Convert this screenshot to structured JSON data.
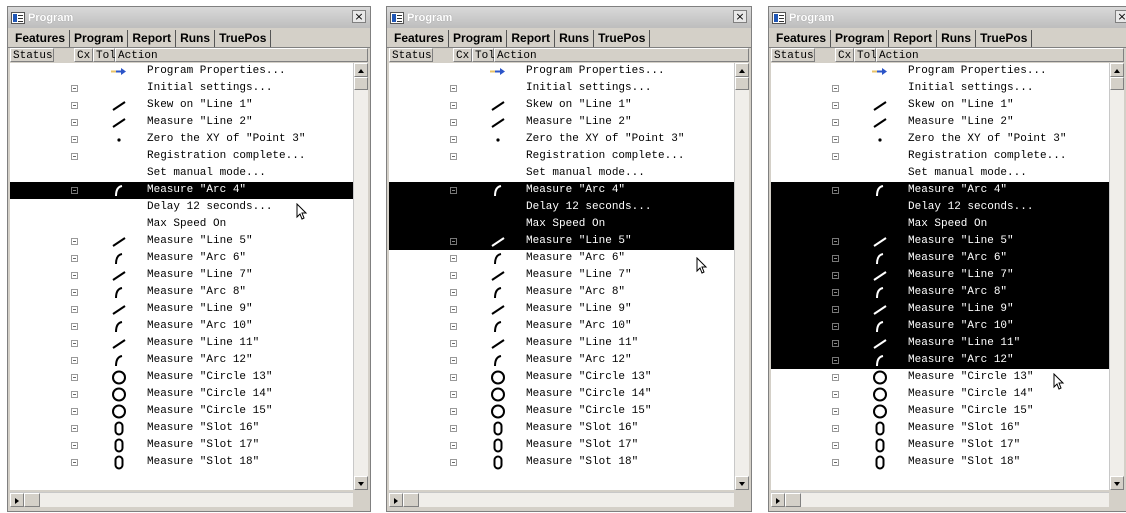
{
  "windows": [
    {
      "title": "Program",
      "close": "×",
      "tabs": [
        "Features",
        "Program",
        "Report",
        "Runs",
        "TruePos"
      ],
      "columns": {
        "status": "Status",
        "cx": "Cx",
        "tol": "Tol",
        "action": "Action"
      },
      "rows": [
        {
          "icon": "arrow",
          "text": "Program Properties...",
          "expander": false,
          "selected": false
        },
        {
          "icon": "none",
          "text": "Initial settings...",
          "expander": true,
          "selected": false
        },
        {
          "icon": "line",
          "text": "Skew on \"Line 1\"",
          "expander": true,
          "selected": false
        },
        {
          "icon": "line",
          "text": "Measure \"Line 2\"",
          "expander": true,
          "selected": false
        },
        {
          "icon": "point",
          "text": "Zero the XY of \"Point 3\"",
          "expander": true,
          "selected": false
        },
        {
          "icon": "none",
          "text": "Registration complete...",
          "expander": true,
          "selected": false
        },
        {
          "icon": "none",
          "text": "Set manual mode...",
          "expander": false,
          "selected": false
        },
        {
          "icon": "arc",
          "text": "Measure \"Arc 4\"",
          "expander": true,
          "selected": true
        },
        {
          "icon": "none",
          "text": "Delay 12 seconds...",
          "expander": false,
          "selected": false
        },
        {
          "icon": "none",
          "text": "Max Speed On",
          "expander": false,
          "selected": false
        },
        {
          "icon": "line",
          "text": "Measure \"Line 5\"",
          "expander": true,
          "selected": false
        },
        {
          "icon": "arc",
          "text": "Measure \"Arc 6\"",
          "expander": true,
          "selected": false
        },
        {
          "icon": "line",
          "text": "Measure \"Line 7\"",
          "expander": true,
          "selected": false
        },
        {
          "icon": "arc",
          "text": "Measure \"Arc 8\"",
          "expander": true,
          "selected": false
        },
        {
          "icon": "line",
          "text": "Measure \"Line 9\"",
          "expander": true,
          "selected": false
        },
        {
          "icon": "arc",
          "text": "Measure \"Arc 10\"",
          "expander": true,
          "selected": false
        },
        {
          "icon": "line",
          "text": "Measure \"Line 11\"",
          "expander": true,
          "selected": false
        },
        {
          "icon": "arc",
          "text": "Measure \"Arc 12\"",
          "expander": true,
          "selected": false
        },
        {
          "icon": "circle",
          "text": "Measure \"Circle 13\"",
          "expander": true,
          "selected": false
        },
        {
          "icon": "circle",
          "text": "Measure \"Circle 14\"",
          "expander": true,
          "selected": false
        },
        {
          "icon": "circle",
          "text": "Measure \"Circle 15\"",
          "expander": true,
          "selected": false
        },
        {
          "icon": "slot",
          "text": "Measure \"Slot 16\"",
          "expander": true,
          "selected": false
        },
        {
          "icon": "slot",
          "text": "Measure \"Slot 17\"",
          "expander": true,
          "selected": false
        },
        {
          "icon": "slot",
          "text": "Measure \"Slot 18\"",
          "expander": true,
          "selected": false
        }
      ]
    },
    {
      "title": "Program",
      "close": "×",
      "tabs": [
        "Features",
        "Program",
        "Report",
        "Runs",
        "TruePos"
      ],
      "columns": {
        "status": "Status",
        "cx": "Cx",
        "tol": "Tol",
        "action": "Action"
      },
      "rows": [
        {
          "icon": "arrow",
          "text": "Program Properties...",
          "expander": false,
          "selected": false
        },
        {
          "icon": "none",
          "text": "Initial settings...",
          "expander": true,
          "selected": false
        },
        {
          "icon": "line",
          "text": "Skew on \"Line 1\"",
          "expander": true,
          "selected": false
        },
        {
          "icon": "line",
          "text": "Measure \"Line 2\"",
          "expander": true,
          "selected": false
        },
        {
          "icon": "point",
          "text": "Zero the XY of \"Point 3\"",
          "expander": true,
          "selected": false
        },
        {
          "icon": "none",
          "text": "Registration complete...",
          "expander": true,
          "selected": false
        },
        {
          "icon": "none",
          "text": "Set manual mode...",
          "expander": false,
          "selected": false
        },
        {
          "icon": "arc",
          "text": "Measure \"Arc 4\"",
          "expander": true,
          "selected": true
        },
        {
          "icon": "none",
          "text": "Delay 12 seconds...",
          "expander": false,
          "selected": true
        },
        {
          "icon": "none",
          "text": "Max Speed On",
          "expander": false,
          "selected": true
        },
        {
          "icon": "line",
          "text": "Measure \"Line 5\"",
          "expander": true,
          "selected": true
        },
        {
          "icon": "arc",
          "text": "Measure \"Arc 6\"",
          "expander": true,
          "selected": false
        },
        {
          "icon": "line",
          "text": "Measure \"Line 7\"",
          "expander": true,
          "selected": false
        },
        {
          "icon": "arc",
          "text": "Measure \"Arc 8\"",
          "expander": true,
          "selected": false
        },
        {
          "icon": "line",
          "text": "Measure \"Line 9\"",
          "expander": true,
          "selected": false
        },
        {
          "icon": "arc",
          "text": "Measure \"Arc 10\"",
          "expander": true,
          "selected": false
        },
        {
          "icon": "line",
          "text": "Measure \"Line 11\"",
          "expander": true,
          "selected": false
        },
        {
          "icon": "arc",
          "text": "Measure \"Arc 12\"",
          "expander": true,
          "selected": false
        },
        {
          "icon": "circle",
          "text": "Measure \"Circle 13\"",
          "expander": true,
          "selected": false
        },
        {
          "icon": "circle",
          "text": "Measure \"Circle 14\"",
          "expander": true,
          "selected": false
        },
        {
          "icon": "circle",
          "text": "Measure \"Circle 15\"",
          "expander": true,
          "selected": false
        },
        {
          "icon": "slot",
          "text": "Measure \"Slot 16\"",
          "expander": true,
          "selected": false
        },
        {
          "icon": "slot",
          "text": "Measure \"Slot 17\"",
          "expander": true,
          "selected": false
        },
        {
          "icon": "slot",
          "text": "Measure \"Slot 18\"",
          "expander": true,
          "selected": false
        }
      ]
    },
    {
      "title": "Program",
      "close": "×",
      "tabs": [
        "Features",
        "Program",
        "Report",
        "Runs",
        "TruePos"
      ],
      "columns": {
        "status": "Status",
        "cx": "Cx",
        "tol": "Tol",
        "action": "Action"
      },
      "rows": [
        {
          "icon": "arrow",
          "text": "Program Properties...",
          "expander": false,
          "selected": false
        },
        {
          "icon": "none",
          "text": "Initial settings...",
          "expander": true,
          "selected": false
        },
        {
          "icon": "line",
          "text": "Skew on \"Line 1\"",
          "expander": true,
          "selected": false
        },
        {
          "icon": "line",
          "text": "Measure \"Line 2\"",
          "expander": true,
          "selected": false
        },
        {
          "icon": "point",
          "text": "Zero the XY of \"Point 3\"",
          "expander": true,
          "selected": false
        },
        {
          "icon": "none",
          "text": "Registration complete...",
          "expander": true,
          "selected": false
        },
        {
          "icon": "none",
          "text": "Set manual mode...",
          "expander": false,
          "selected": false
        },
        {
          "icon": "arc",
          "text": "Measure \"Arc 4\"",
          "expander": true,
          "selected": true
        },
        {
          "icon": "none",
          "text": "Delay 12 seconds...",
          "expander": false,
          "selected": true
        },
        {
          "icon": "none",
          "text": "Max Speed On",
          "expander": false,
          "selected": true
        },
        {
          "icon": "line",
          "text": "Measure \"Line 5\"",
          "expander": true,
          "selected": true
        },
        {
          "icon": "arc",
          "text": "Measure \"Arc 6\"",
          "expander": true,
          "selected": true
        },
        {
          "icon": "line",
          "text": "Measure \"Line 7\"",
          "expander": true,
          "selected": true
        },
        {
          "icon": "arc",
          "text": "Measure \"Arc 8\"",
          "expander": true,
          "selected": true
        },
        {
          "icon": "line",
          "text": "Measure \"Line 9\"",
          "expander": true,
          "selected": true
        },
        {
          "icon": "arc",
          "text": "Measure \"Arc 10\"",
          "expander": true,
          "selected": true
        },
        {
          "icon": "line",
          "text": "Measure \"Line 11\"",
          "expander": true,
          "selected": true
        },
        {
          "icon": "arc",
          "text": "Measure \"Arc 12\"",
          "expander": true,
          "selected": true
        },
        {
          "icon": "circle",
          "text": "Measure \"Circle 13\"",
          "expander": true,
          "selected": false
        },
        {
          "icon": "circle",
          "text": "Measure \"Circle 14\"",
          "expander": true,
          "selected": false
        },
        {
          "icon": "circle",
          "text": "Measure \"Circle 15\"",
          "expander": true,
          "selected": false
        },
        {
          "icon": "slot",
          "text": "Measure \"Slot 16\"",
          "expander": true,
          "selected": false
        },
        {
          "icon": "slot",
          "text": "Measure \"Slot 17\"",
          "expander": true,
          "selected": false
        },
        {
          "icon": "slot",
          "text": "Measure \"Slot 18\"",
          "expander": true,
          "selected": false
        }
      ]
    }
  ],
  "colors": {
    "arrow": "#2b54c8",
    "arrow_tail": "#e8c36a",
    "selection": "#000000"
  }
}
